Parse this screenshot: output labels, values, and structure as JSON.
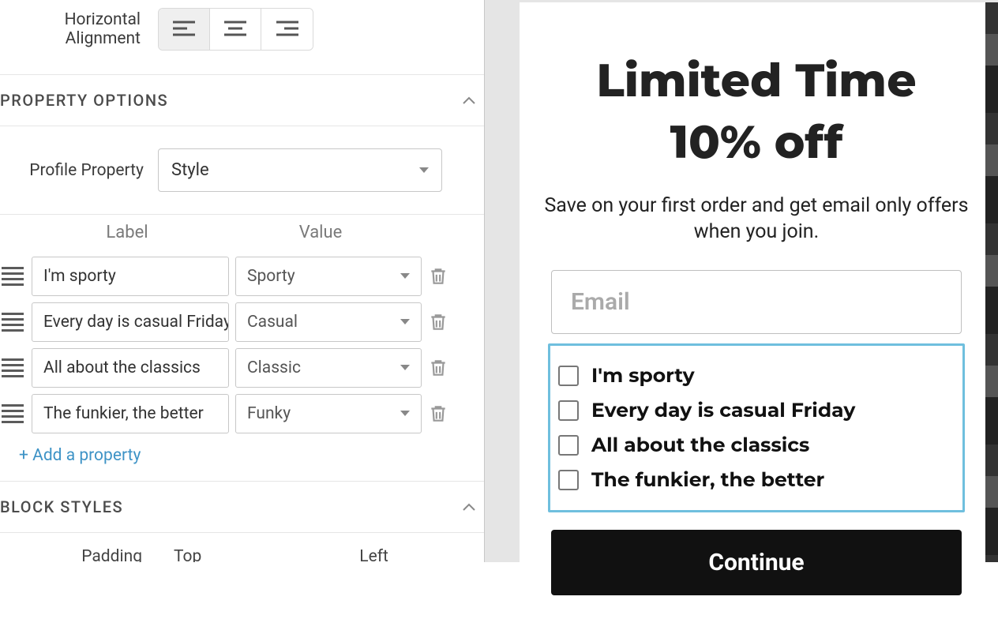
{
  "alignment": {
    "label": "Horizontal Alignment",
    "active": "left"
  },
  "sections": {
    "property_options": "PROPERTY OPTIONS",
    "block_styles": "BLOCK STYLES"
  },
  "profile": {
    "label": "Profile Property",
    "value": "Style"
  },
  "columns": {
    "label": "Label",
    "value": "Value"
  },
  "rows": [
    {
      "label": "I'm sporty",
      "value": "Sporty"
    },
    {
      "label": "Every day is casual Friday",
      "value": "Casual"
    },
    {
      "label": "All about the classics",
      "value": "Classic"
    },
    {
      "label": "The funkier, the better",
      "value": "Funky"
    }
  ],
  "add_link": "+ Add a property",
  "padding": {
    "label": "Padding",
    "top": "Top",
    "left": "Left"
  },
  "preview": {
    "headline_l1": "Limited Time",
    "headline_l2": "10% off",
    "subtext": "Save on your first order and get email only offers when you join.",
    "email_placeholder": "Email",
    "options": [
      "I'm sporty",
      "Every day is casual Friday",
      "All about the classics",
      "The funkier, the better"
    ],
    "cta": "Continue"
  }
}
